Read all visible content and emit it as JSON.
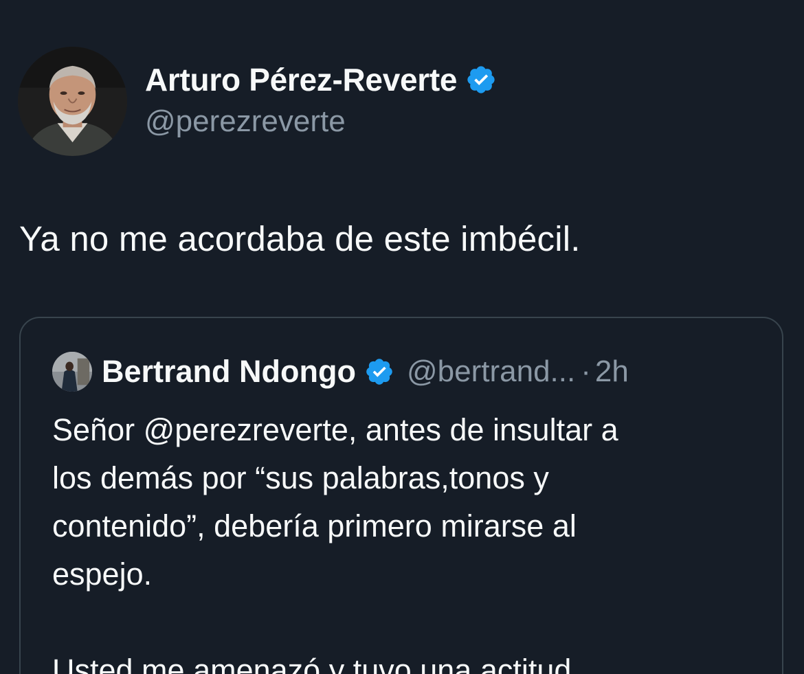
{
  "tweet": {
    "author": {
      "name": "Arturo Pérez-Reverte",
      "handle": "@perezreverte",
      "verified_icon": "verified-badge-icon",
      "avatar": "author-avatar"
    },
    "text": "Ya no me acordaba de este imbécil."
  },
  "quoted_tweet": {
    "author": {
      "name": "Bertrand Ndongo",
      "handle": "@bertrand...",
      "verified_icon": "verified-badge-icon",
      "avatar": "quoted-author-avatar"
    },
    "separator": "·",
    "time": "2h",
    "body": {
      "line1": "Señor @perezreverte, antes de insultar a",
      "line2": "los demás por “sus palabras,tonos y",
      "line3": "contenido”, debería primero mirarse al",
      "line4": "espejo.",
      "line5": "Usted me amenazó y tuvo una actitud"
    }
  },
  "colors": {
    "background": "#161d27",
    "text": "#f7f9f9",
    "secondary_text": "#8b98a5",
    "verified_blue": "#1d9bf0",
    "card_border": "#38444d"
  }
}
